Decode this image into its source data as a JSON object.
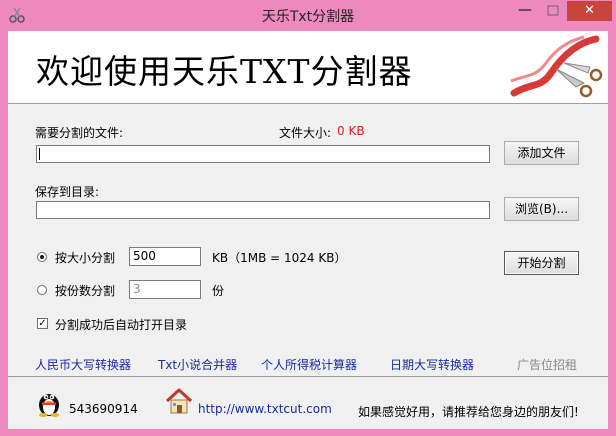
{
  "window": {
    "title": "天乐Txt分割器",
    "min_glyph": "—",
    "max_glyph": "□",
    "close_glyph": "✕"
  },
  "banner": {
    "heading": "欢迎使用天乐TXT分割器"
  },
  "form": {
    "source_label": "需要分割的文件:",
    "file_size_label": "文件大小:",
    "file_size_value": "0 KB",
    "source_value": "",
    "add_file_button": "添加文件",
    "save_dir_label": "保存到目录:",
    "save_dir_value": "",
    "browse_button": "浏览(B)...",
    "split_by_size_label": "按大小分割",
    "split_by_size_value": "500",
    "size_unit_hint": "KB（1MB = 1024 KB）",
    "split_by_count_label": "按份数分割",
    "split_by_count_value": "3",
    "count_unit": "份",
    "start_button": "开始分割",
    "auto_open_label": "分割成功后自动打开目录",
    "auto_open_checked": true,
    "split_mode": "size"
  },
  "links": {
    "rmb_converter": "人民币大写转换器",
    "txt_merger": "Txt小说合并器",
    "tax_calculator": "个人所得税计算器",
    "date_converter": "日期大写转换器",
    "ad_space": "广告位招租"
  },
  "footer": {
    "qq_number": "543690914",
    "website": "http://www.txtcut.com",
    "share_text": "如果感觉好用，请推荐给您身边的朋友们!"
  },
  "colors": {
    "frame": "#ee89c0",
    "close_button": "#c7453c",
    "link": "#1a2aa0",
    "file_size": "#e02020"
  },
  "icons": {
    "app": "scissors-icon",
    "banner": "scissors-ribbon-icon",
    "qq": "qq-penguin-icon",
    "home": "home-icon"
  }
}
